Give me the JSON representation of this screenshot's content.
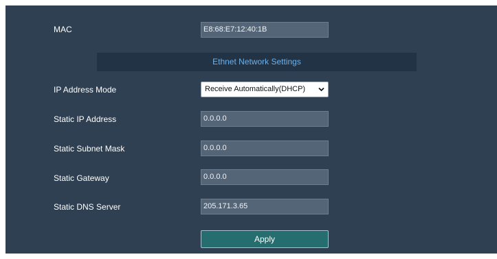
{
  "mac": {
    "label": "MAC",
    "value": "E8:68:E7:12:40:1B"
  },
  "section": {
    "title": "Ethnet Network Settings"
  },
  "ip_mode": {
    "label": "IP Address Mode",
    "selected": "Receive Automatically(DHCP)"
  },
  "static_ip": {
    "label": "Static IP Address",
    "value": "0.0.0.0"
  },
  "subnet": {
    "label": "Static Subnet Mask",
    "value": "0.0.0.0"
  },
  "gateway": {
    "label": "Static Gateway",
    "value": "0.0.0.0"
  },
  "dns": {
    "label": "Static DNS Server",
    "value": "205.171.3.65"
  },
  "apply": {
    "label": "Apply"
  },
  "icons": {
    "select_chevron": "chevron-down-icon"
  },
  "colors": {
    "panel": "#2e4052",
    "header": "#223345",
    "header_text": "#6fb1ea",
    "apply_button": "#256d6e"
  }
}
